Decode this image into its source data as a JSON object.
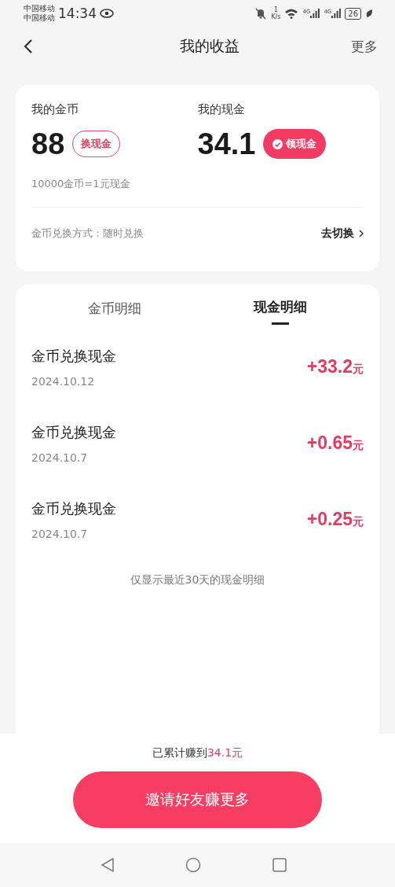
{
  "status_bar": {
    "carriers": [
      "中国移动",
      "中国移动"
    ],
    "time": "14:34",
    "speed_value": "1",
    "speed_unit": "K/s",
    "networks": [
      "4G",
      "4G"
    ],
    "battery": "26"
  },
  "header": {
    "title": "我的收益",
    "more": "更多"
  },
  "summary": {
    "wallets": [
      {
        "label": "我的金币",
        "amount": "88",
        "action": "换现金",
        "kind": "outline"
      },
      {
        "label": "我的现金",
        "amount": "34.1",
        "action": "领现金",
        "kind": "filled"
      }
    ],
    "rate": "10000金币=1元现金",
    "mode": "金币兑换方式：随时兑换",
    "switch": "去切换"
  },
  "tabs": [
    {
      "label": "金币明细",
      "selected": false
    },
    {
      "label": "现金明细",
      "selected": true
    }
  ],
  "records": [
    {
      "title": "金币兑换现金",
      "date": "2024.10.12",
      "amount": "+33.2",
      "unit": "元"
    },
    {
      "title": "金币兑换现金",
      "date": "2024.10.7",
      "amount": "+0.65",
      "unit": "元"
    },
    {
      "title": "金币兑换现金",
      "date": "2024.10.7",
      "amount": "+0.25",
      "unit": "元"
    }
  ],
  "note": "仅显示最近30天的现金明细",
  "footer": {
    "total_prefix": "已累计赚到",
    "total_value": "34.1元",
    "button": "邀请好友赚更多"
  }
}
